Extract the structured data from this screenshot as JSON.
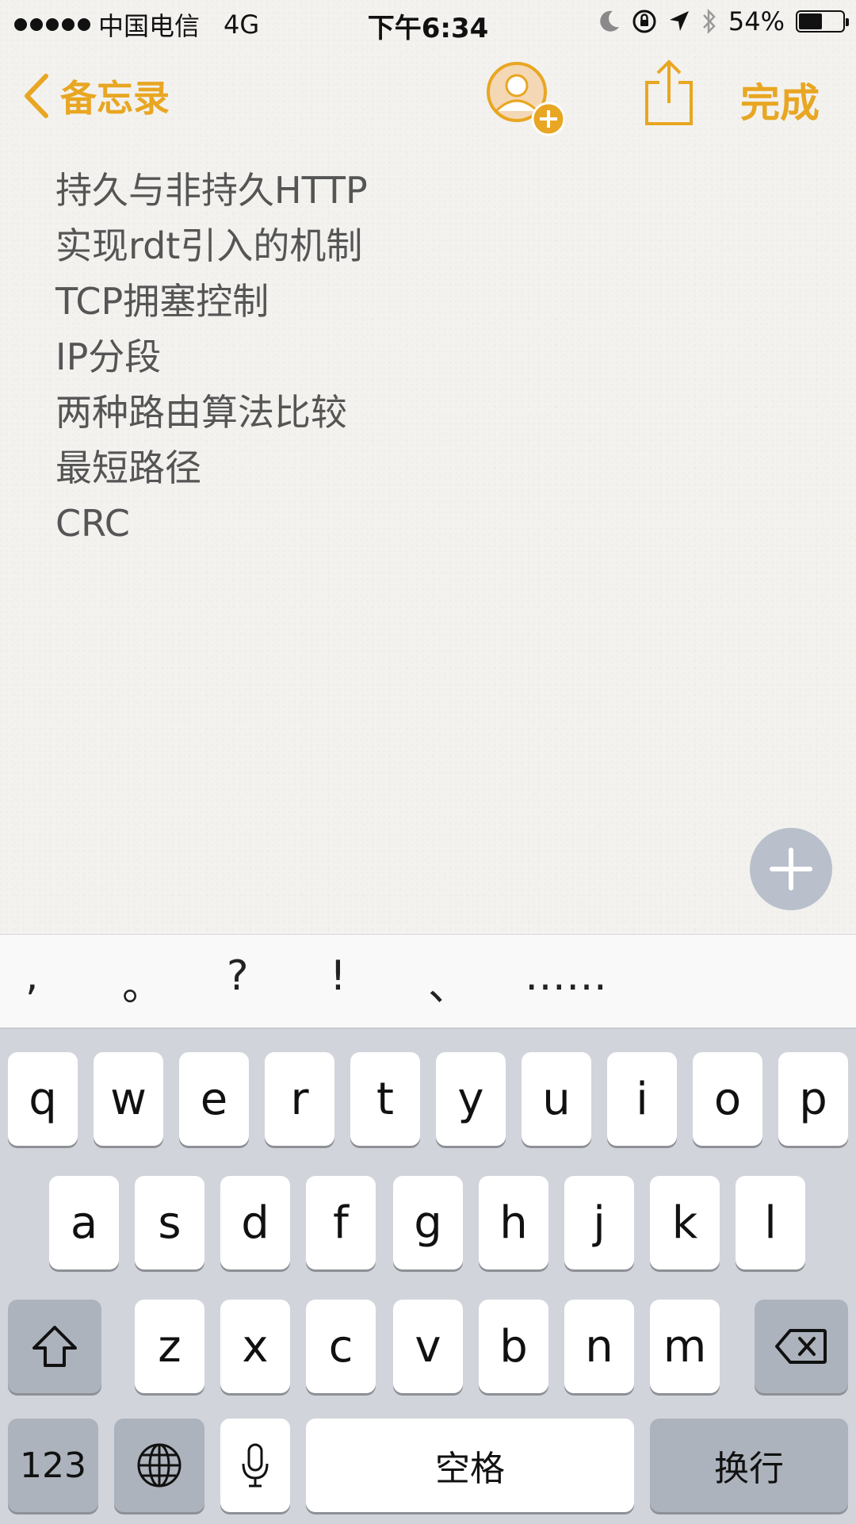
{
  "status_bar": {
    "carrier": "中国电信",
    "network": "4G",
    "time": "下午6:34",
    "battery": "54%",
    "battery_level": 0.54
  },
  "nav": {
    "back_label": "备忘录",
    "done_label": "完成",
    "icons": [
      "chevron-left-icon",
      "add-person-icon",
      "share-icon"
    ]
  },
  "note": {
    "lines": [
      "持久与非持久HTTP",
      "实现rdt引入的机制",
      "TCP拥塞控制",
      "IP分段",
      "两种路由算法比较",
      "最短路径",
      "CRC"
    ]
  },
  "punctuation": [
    ",",
    "。",
    "?",
    "!",
    "、",
    "……"
  ],
  "keyboard": {
    "row1": [
      "q",
      "w",
      "e",
      "r",
      "t",
      "y",
      "u",
      "i",
      "o",
      "p"
    ],
    "row2": [
      "a",
      "s",
      "d",
      "f",
      "g",
      "h",
      "j",
      "k",
      "l"
    ],
    "row3": [
      "z",
      "x",
      "c",
      "v",
      "b",
      "n",
      "m"
    ],
    "numbers_label": "123",
    "space_label": "空格",
    "return_label": "换行"
  },
  "colors": {
    "accent": "#e8a622",
    "keyboard_bg": "#d1d4db",
    "fab_bg": "#b9c0cc"
  }
}
